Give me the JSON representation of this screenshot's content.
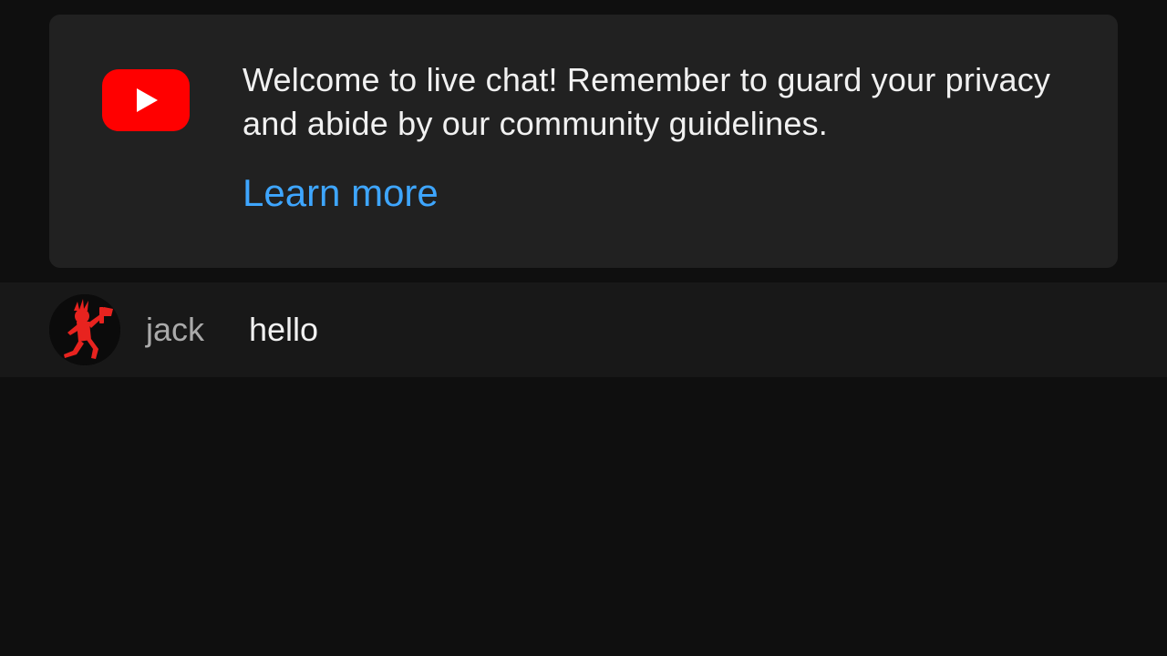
{
  "welcome": {
    "logo_icon": "youtube-play-icon",
    "text": "Welcome to live chat! Remember to guard your privacy and abide by our community guidelines.",
    "link_label": "Learn more"
  },
  "messages": [
    {
      "avatar_icon": "hatchetman-avatar-icon",
      "author": "jack",
      "text": "hello"
    }
  ],
  "colors": {
    "background": "#0f0f0f",
    "card": "#212121",
    "row": "#181818",
    "link": "#3ea6ff",
    "brand_red": "#ff0000",
    "author": "#aaaaaa",
    "text": "#f1f1f1"
  }
}
